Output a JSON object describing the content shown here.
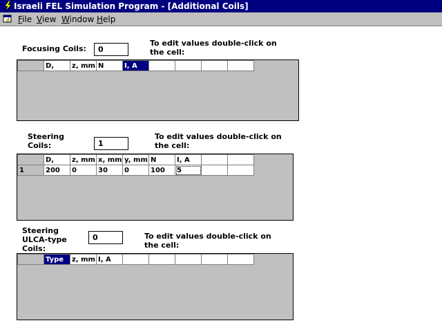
{
  "window": {
    "title": "Israeli FEL Simulation Program - [Additional Coils]"
  },
  "menu": {
    "file": "File",
    "view": "View",
    "window": "Window",
    "help": "Help"
  },
  "hint": {
    "line1": "To edit values double-click on",
    "line2": "the cell:"
  },
  "focusing": {
    "label": "Focusing Coils:",
    "count": "0",
    "columns": [
      "",
      "D,",
      "z, mm",
      "N",
      "I, A",
      "",
      "",
      "",
      ""
    ],
    "selected_column": 4
  },
  "steering": {
    "label_line1": "Steering",
    "label_line2": "Coils:",
    "count": "1",
    "columns": [
      "",
      "D,",
      "z, mm",
      "x, mm",
      "y, mm",
      "N",
      "I, A",
      "",
      ""
    ],
    "rows": [
      [
        "1",
        "200",
        "0",
        "30",
        "0",
        "100",
        "5",
        "",
        ""
      ]
    ],
    "focused_cell": [
      0,
      6
    ]
  },
  "ulca": {
    "label_line1": "Steering",
    "label_line2": "ULCA-type",
    "label_line3": "Coils:",
    "count": "0",
    "columns": [
      "",
      "Type",
      "z, mm",
      "I, A",
      "",
      "",
      "",
      "",
      ""
    ],
    "selected_column": 1
  },
  "colors": {
    "titlebar": "#000080",
    "face": "#c0c0c0",
    "selection": "#000080"
  },
  "icons": {
    "app": "lightning-bolt-icon",
    "mdi": "document-window-icon"
  }
}
